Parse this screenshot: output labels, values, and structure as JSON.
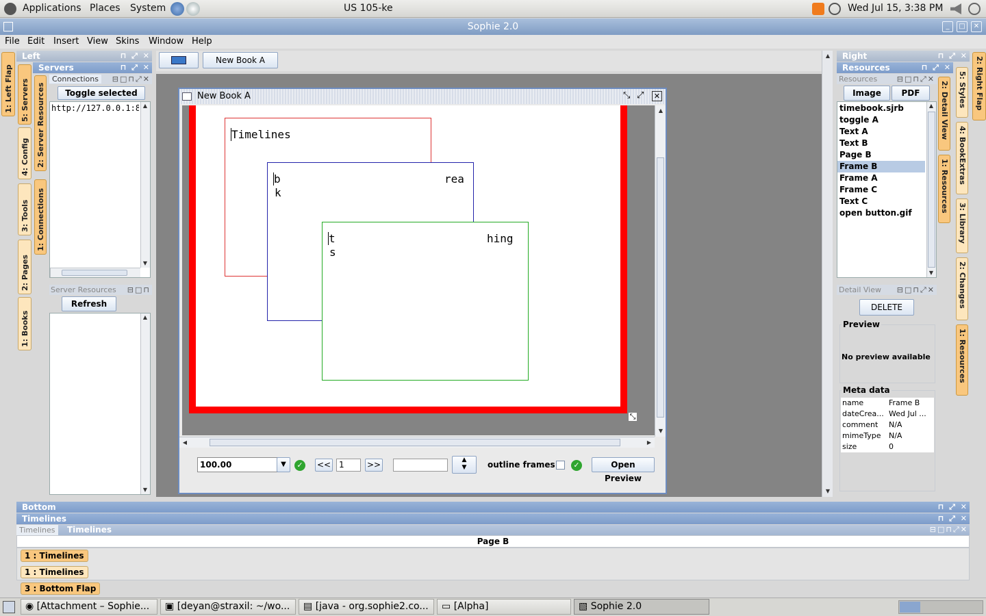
{
  "gnome": {
    "applications": "Applications",
    "places": "Places",
    "system": "System",
    "keyboard": "US 105-ke",
    "clock": "Wed Jul 15,  3:38 PM"
  },
  "window": {
    "title": "Sophie 2.0"
  },
  "menu": [
    "File",
    "Edit",
    "Insert",
    "View",
    "Skins",
    "Window",
    "Help"
  ],
  "left": {
    "title": "Left",
    "servers_title": "Servers",
    "connections_tab": "Connections",
    "toggle_btn": "Toggle selected",
    "server_url": "http://127.0.0.1:800",
    "server_resources_tab": "Server Resources",
    "refresh_btn": "Refresh",
    "outer_tabs": [
      "1: Left Flap",
      "5: Servers",
      "4: Config",
      "3: Tools",
      "2: Pages",
      "1: Books"
    ],
    "inner_tabs": [
      "2: Server Resources",
      "1: Connections"
    ]
  },
  "toolbar": {
    "book_tab": "New Book A"
  },
  "book": {
    "title": "New Book A",
    "frame1_text": "Timelines",
    "frame2_text_a": "b",
    "frame2_text_b": "k",
    "frame2_text_c": "rea",
    "frame3_text_a": "t",
    "frame3_text_b": "s",
    "frame3_text_c": "hing",
    "zoom": "100.00",
    "page_prev": "<<",
    "page_num": "1",
    "page_next": ">>",
    "outline_label": "outline frames",
    "preview_btn": "Open Preview"
  },
  "right": {
    "title": "Right",
    "resources_title": "Resources",
    "resources_tab": "Resources",
    "image_btn": "Image",
    "pdf_btn": "PDF",
    "items": [
      "timebook.sjrb",
      "toggle A",
      "Text A",
      "Text B",
      "Page B",
      "Frame B",
      "Frame A",
      "Frame C",
      "Text C",
      "open button.gif"
    ],
    "selected": "Frame B",
    "detail_tab": "Detail View",
    "delete_btn": "DELETE",
    "preview_label": "Preview",
    "no_preview": "No preview available",
    "meta_label": "Meta data",
    "meta": [
      {
        "k": "name",
        "v": "Frame B"
      },
      {
        "k": "dateCrea...",
        "v": "Wed Jul ..."
      },
      {
        "k": "comment",
        "v": "N/A"
      },
      {
        "k": "mimeType",
        "v": "N/A"
      },
      {
        "k": "size",
        "v": "0"
      }
    ],
    "inner_tabs": [
      "2: Detail View",
      "1: Resources"
    ],
    "outer_tabs": [
      "2: Right Flap",
      "5: Styles",
      "4: BookExtras",
      "3: Library",
      "2: Changes",
      "1: Resources"
    ]
  },
  "bottom": {
    "title": "Bottom",
    "timelines_title": "Timelines",
    "tab_a": "Timelines",
    "tab_b": "Timelines",
    "page_label": "Page B",
    "flap_tabs": [
      "1 : Timelines",
      "1 : Timelines",
      "3 : Bottom Flap"
    ]
  },
  "taskbar": [
    "[Attachment – Sophie...",
    "[deyan@straxil: ~/wo...",
    "[java - org.sophie2.co...",
    "[Alpha]",
    "Sophie 2.0"
  ]
}
